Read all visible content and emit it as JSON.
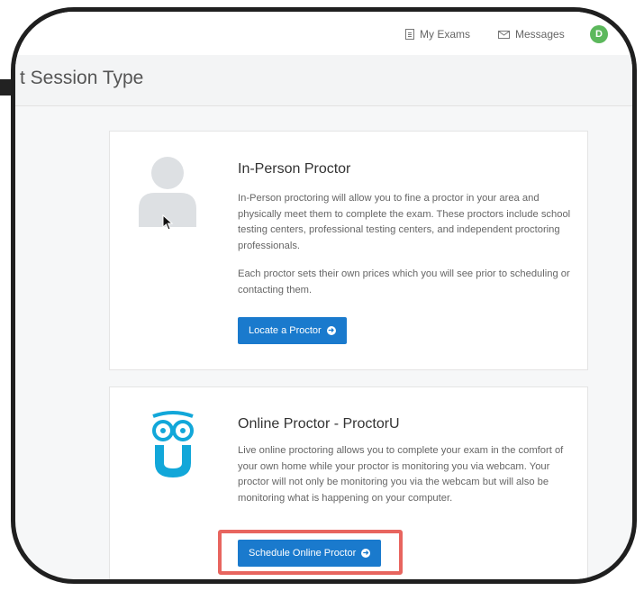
{
  "nav": {
    "my_exams": "My Exams",
    "messages": "Messages",
    "avatar_initial": "D"
  },
  "page": {
    "title": "t Session Type"
  },
  "cards": [
    {
      "title": "In-Person Proctor",
      "paragraph1": "In-Person proctoring will allow you to fine a proctor in your area and physically meet them to complete the exam. These proctors include school testing centers, professional testing centers, and independent proctoring professionals.",
      "paragraph2": "Each proctor sets their own prices which you will see prior to scheduling or contacting them.",
      "button": "Locate a Proctor",
      "icon": "person-silhouette-icon"
    },
    {
      "title": "Online Proctor - ProctorU",
      "paragraph1": "Live online proctoring allows you to complete your exam in the comfort of your own home while your proctor is monitoring you via webcam. Your proctor will not only be monitoring you via the webcam but will also be monitoring what is happening on your computer.",
      "button": "Schedule Online Proctor",
      "icon": "proctoru-owl-logo"
    }
  ],
  "colors": {
    "primary_button": "#1a7acd",
    "highlight": "#e8655f",
    "owl_logo": "#12a7d9",
    "avatar": "#5cb85c"
  }
}
